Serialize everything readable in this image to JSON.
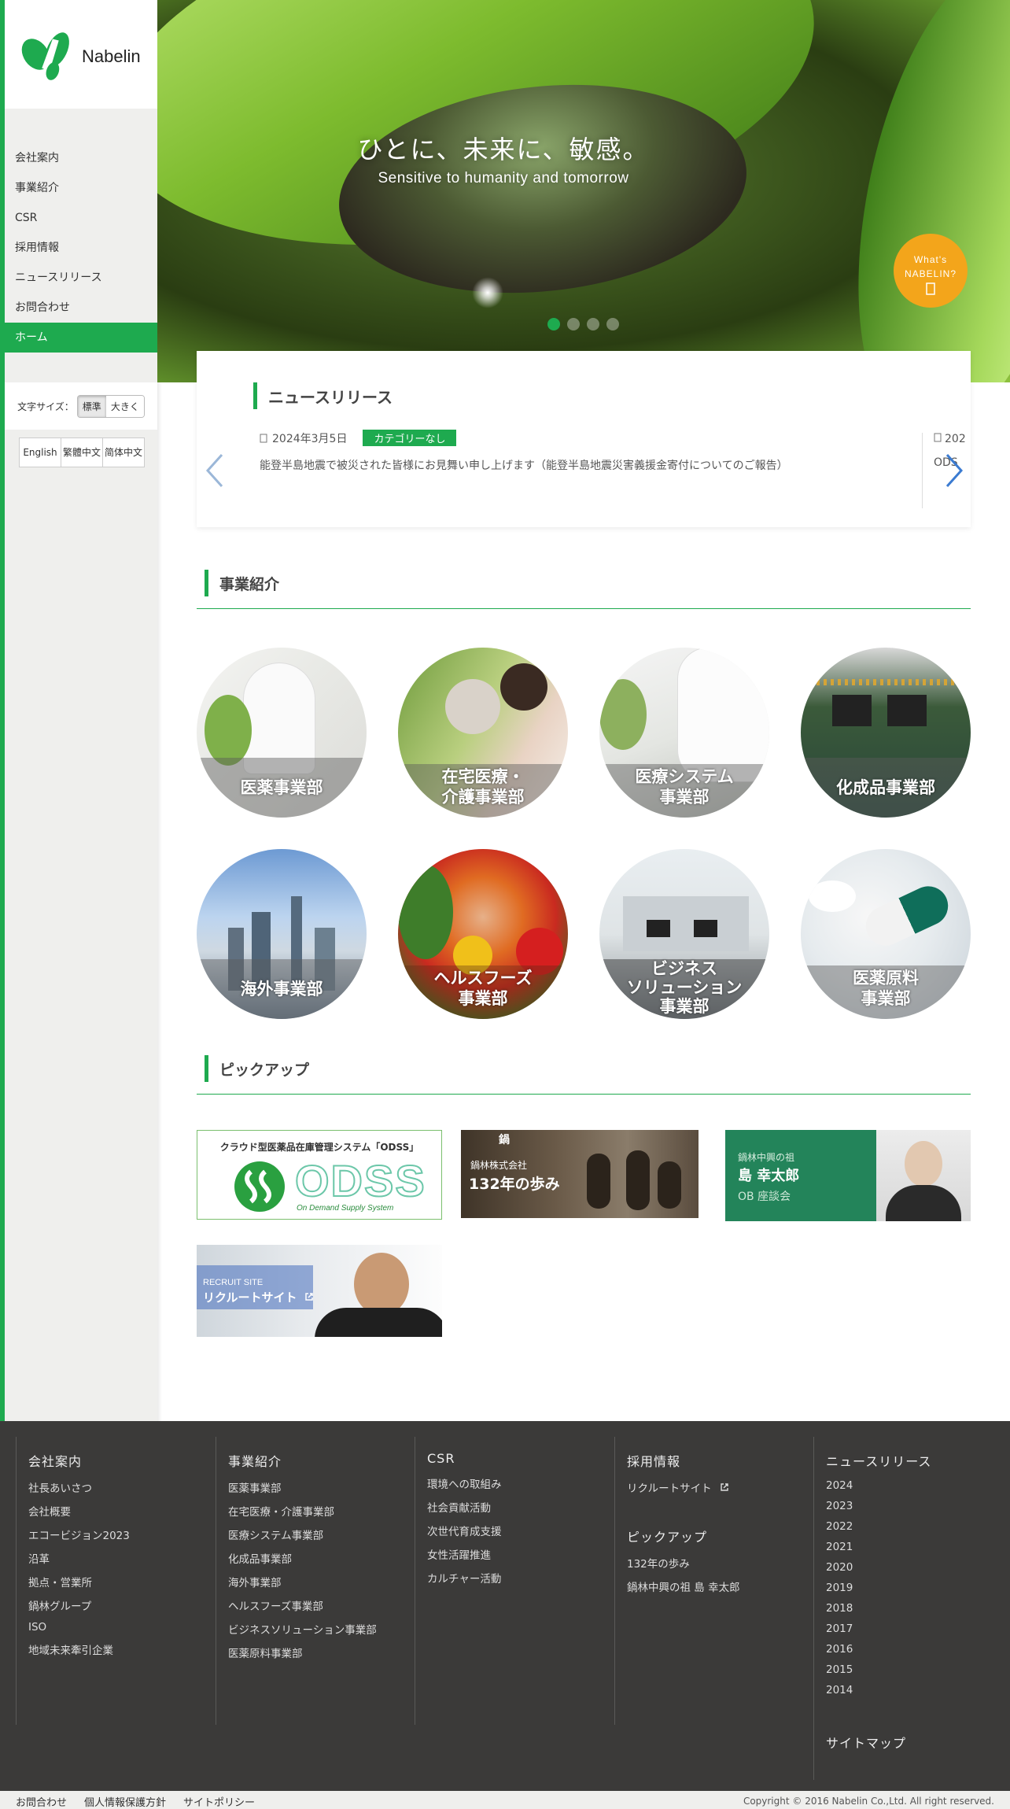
{
  "brand": {
    "name": "Nabelin"
  },
  "sidebar": {
    "nav": [
      "会社案内",
      "事業紹介",
      "CSR",
      "採用情報",
      "ニュースリリース",
      "お問合わせ",
      "ホーム"
    ],
    "font_size_label": "文字サイズ：",
    "font_size_options": [
      "標準",
      "大きく"
    ],
    "languages": [
      "English",
      "繁體中文",
      "简体中文"
    ]
  },
  "hero": {
    "title": "ひとに、未来に、敏感。",
    "subtitle": "Sensitive to humanity and tomorrow",
    "badge_line1": "What's",
    "badge_line2": "NABELIN?",
    "slide_count": 4,
    "active_slide": 1
  },
  "news": {
    "heading": "ニュースリリース",
    "item": {
      "date": "2024年3月5日",
      "category": "カテゴリーなし",
      "text": "能登半島地震で被災された皆様にお見舞い申し上げます（能登半島地震災害義援金寄付についてのご報告）"
    },
    "next_item_date_partial": "202",
    "next_item_text_partial": "ODS"
  },
  "business": {
    "heading": "事業紹介",
    "items": [
      {
        "l1": "医薬事業部",
        "l2": ""
      },
      {
        "l1": "在宅医療・",
        "l2": "介護事業部"
      },
      {
        "l1": "医療システム",
        "l2": "事業部"
      },
      {
        "l1": "化成品事業部",
        "l2": ""
      },
      {
        "l1": "海外事業部",
        "l2": ""
      },
      {
        "l1": "ヘルスフーズ",
        "l2": "事業部"
      },
      {
        "l1": "ビジネス",
        "l2": "ソリューション",
        "l3": "事業部"
      },
      {
        "l1": "医薬原料",
        "l2": "事業部"
      }
    ]
  },
  "pickup": {
    "heading": "ピックアップ",
    "odss": {
      "caption": "クラウド型医薬品在庫管理システム「ODSS」",
      "logo": "ODSS",
      "tagline": "On Demand Supply System"
    },
    "history": {
      "company": "鍋林株式会社",
      "title": "132年の歩み",
      "mark": "鍋"
    },
    "founder": {
      "role": "鍋林中興の祖",
      "name": "島 幸太郎",
      "sub": "OB 座談会"
    },
    "recruit": {
      "small": "RECRUIT SITE",
      "title": "リクルートサイト"
    }
  },
  "footer": {
    "columns": [
      {
        "title": "会社案内",
        "links": [
          "社長あいさつ",
          "会社概要",
          "エコービジョン2023",
          "沿革",
          "拠点・営業所",
          "鍋林グループ",
          "ISO",
          "地域未来牽引企業"
        ]
      },
      {
        "title": "事業紹介",
        "links": [
          "医薬事業部",
          "在宅医療・介護事業部",
          "医療システム事業部",
          "化成品事業部",
          "海外事業部",
          "ヘルスフーズ事業部",
          "ビジネスソリューション事業部",
          "医薬原料事業部"
        ]
      },
      {
        "title": "CSR",
        "links": [
          "環境への取組み",
          "社会貢献活動",
          "次世代育成支援",
          "女性活躍推進",
          "カルチャー活動"
        ]
      },
      {
        "title": "採用情報",
        "links": [
          "リクルートサイト"
        ],
        "sub_title": "ピックアップ",
        "sub_links": [
          "132年の歩み",
          "鍋林中興の祖 島 幸太郎"
        ]
      },
      {
        "title": "ニュースリリース",
        "links": [
          "2024",
          "2023",
          "2022",
          "2021",
          "2020",
          "2019",
          "2018",
          "2017",
          "2016",
          "2015",
          "2014"
        ],
        "sub_title": "サイトマップ"
      }
    ],
    "bottom_links": [
      "お問合わせ",
      "個人情報保護方針",
      "サイトポリシー"
    ],
    "copyright": "Copyright © 2016 Nabelin Co.,Ltd. All right reserved."
  },
  "colors": {
    "accent": "#1eaa4f",
    "orange": "#f3a51b",
    "footer": "#3b3a39",
    "founder_green": "#23845a"
  }
}
